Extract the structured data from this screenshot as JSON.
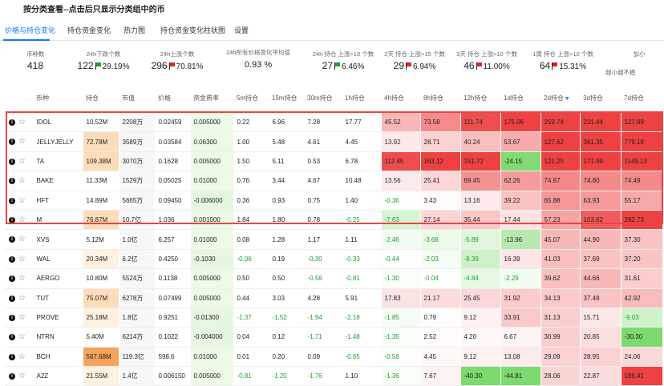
{
  "page_title": "按分类查看--点击后只显示分类组中的币",
  "tabs": [
    "价格与持仓变化",
    "持仓资金变化",
    "热力图",
    "持仓资金变化柱状图",
    "设置"
  ],
  "stats": [
    {
      "label": "币种数",
      "value": "418",
      "pct": "",
      "dir": ""
    },
    {
      "label": "24h下跌个数",
      "value": "122",
      "pct": "29.19%",
      "dir": "up"
    },
    {
      "label": "24h上涨个数",
      "value": "296",
      "pct": "70.81%",
      "dir": "down"
    },
    {
      "label": "24h所有价格变化平均值",
      "value": "0.93 %",
      "pct": "",
      "dir": ""
    },
    {
      "label": "24h 持仓 上涨>10 个数",
      "value": "27",
      "pct": "6.46%",
      "dir": "up"
    },
    {
      "label": "2天 持仓 上涨>15 个数",
      "value": "29",
      "pct": "6.94%",
      "dir": "down"
    },
    {
      "label": "3天 持仓 上涨>10 个数",
      "value": "46",
      "pct": "11.00%",
      "dir": "down"
    },
    {
      "label": "1周 持仓 上涨>10 个数",
      "value": "64",
      "pct": "15.31%",
      "dir": "down"
    },
    {
      "label": "加小",
      "value": "",
      "pct": "",
      "dir": ""
    }
  ],
  "hint": "越小越不稳",
  "columns": [
    "",
    "币种",
    "持仓",
    "市值",
    "价格",
    "资金费率",
    "5m持仓",
    "15m持仓",
    "30m持仓",
    "1h持仓",
    "4h持仓",
    "8h持仓",
    "12h持仓",
    "1d持仓",
    "2d持仓",
    "3d持仓",
    "7d持仓"
  ],
  "rows": [
    {
      "sym": "IDOL",
      "oi": "10.52M",
      "mcap": "2208万",
      "price": "0.02459",
      "fund": "0.005000",
      "v": [
        "0.22",
        "6.96",
        "7.28",
        "17.77",
        "45.52",
        "73.58",
        "111.74",
        "175.06",
        "259.74",
        "231.44",
        "127.89"
      ]
    },
    {
      "sym": "JELLYJELLY",
      "oi": "72.78M",
      "mcap": "3589万",
      "price": "0.03584",
      "fund": "0.06300",
      "v": [
        "1.00",
        "5.48",
        "4.61",
        "4.45",
        "13.92",
        "28.71",
        "40.24",
        "53.67",
        "127.62",
        "361.35",
        "779.18"
      ]
    },
    {
      "sym": "TA",
      "oi": "109.38M",
      "mcap": "3070万",
      "price": "0.1628",
      "fund": "0.005000",
      "v": [
        "1.50",
        "5.11",
        "0.53",
        "6.78",
        "112.45",
        "163.12",
        "151.72",
        "-24.15",
        "121.25",
        "171.99",
        "1149.13"
      ]
    },
    {
      "sym": "BAKE",
      "oi": "11.33M",
      "mcap": "1529万",
      "price": "0.05025",
      "fund": "0.01000",
      "v": [
        "0.76",
        "3.44",
        "4.67",
        "10.48",
        "13.56",
        "25.41",
        "69.45",
        "62.26",
        "74.87",
        "74.80",
        "74.49"
      ]
    },
    {
      "sym": "HFT",
      "oi": "14.89M",
      "mcap": "5665万",
      "price": "0.09450",
      "fund": "-0.006000",
      "v": [
        "0.36",
        "0.93",
        "0.75",
        "1.40",
        "-0.36",
        "3.43",
        "13.16",
        "39.22",
        "65.88",
        "63.93",
        "55.17"
      ]
    },
    {
      "sym": "M",
      "oi": "76.87M",
      "mcap": "10.7亿",
      "price": "1.036",
      "fund": "0.001000",
      "v": [
        "1.84",
        "1.80",
        "0.78",
        "-0.25",
        "-7.63",
        "27.14",
        "35.44",
        "17.44",
        "57.23",
        "103.62",
        "282.73"
      ]
    },
    {
      "sym": "XVS",
      "oi": "5.12M",
      "mcap": "1.0亿",
      "price": "6.257",
      "fund": "0.01000",
      "v": [
        "0.08",
        "1.28",
        "1.17",
        "1.11",
        "-2.46",
        "-3.68",
        "-5.89",
        "-13.96",
        "45.07",
        "44.90",
        "37.30"
      ]
    },
    {
      "sym": "WAL",
      "oi": "20.34M",
      "mcap": "6.2亿",
      "price": "0.4250",
      "fund": "-0.1030",
      "v": [
        "-0.06",
        "0.19",
        "-0.30",
        "-0.33",
        "-0.44",
        "-2.03",
        "-9.39",
        "16.39",
        "41.03",
        "37.69",
        "37.20"
      ]
    },
    {
      "sym": "AERGO",
      "oi": "10.80M",
      "mcap": "5524万",
      "price": "0.1138",
      "fund": "0.005000",
      "v": [
        "0.50",
        "0.50",
        "-0.56",
        "-0.81",
        "-1.30",
        "-0.04",
        "-4.84",
        "-2.29",
        "39.62",
        "44.66",
        "31.61"
      ]
    },
    {
      "sym": "TUT",
      "oi": "75.07M",
      "mcap": "6278万",
      "price": "0.07499",
      "fund": "0.005000",
      "v": [
        "0.44",
        "3.03",
        "4.28",
        "5.91",
        "17.83",
        "21.17",
        "25.45",
        "31.92",
        "34.13",
        "37.48",
        "42.92"
      ]
    },
    {
      "sym": "PROVE",
      "oi": "25.18M",
      "mcap": "1.8亿",
      "price": "0.9251",
      "fund": "-0.01300",
      "v": [
        "-1.37",
        "-1.52",
        "-1.94",
        "-2.18",
        "-1.85",
        "0.79",
        "9.12",
        "33.91",
        "31.13",
        "15.71",
        "-9.03"
      ]
    },
    {
      "sym": "NTRN",
      "oi": "5.40M",
      "mcap": "6214万",
      "price": "0.1022",
      "fund": "-0.004000",
      "v": [
        "0.04",
        "0.12",
        "-1.71",
        "-1.48",
        "-1.35",
        "2.52",
        "4.20",
        "6.67",
        "30.99",
        "20.85",
        "-30.30"
      ]
    },
    {
      "sym": "BCH",
      "oi": "567.68M",
      "mcap": "119.3亿",
      "price": "598.6",
      "fund": "0.01000",
      "v": [
        "0.01",
        "0.20",
        "0.09",
        "-0.65",
        "-0.58",
        "4.45",
        "9.12",
        "13.08",
        "29.09",
        "28.95",
        "24.06"
      ]
    },
    {
      "sym": "A2Z",
      "oi": "21.55M",
      "mcap": "1.4亿",
      "price": "0.006150",
      "fund": "0.005000",
      "v": [
        "-0.81",
        "-1.20",
        "-1.76",
        "1.10",
        "-1.36",
        "7.67",
        "-40.30",
        "-44.81",
        "28.06",
        "22.87",
        "186.41"
      ]
    }
  ]
}
